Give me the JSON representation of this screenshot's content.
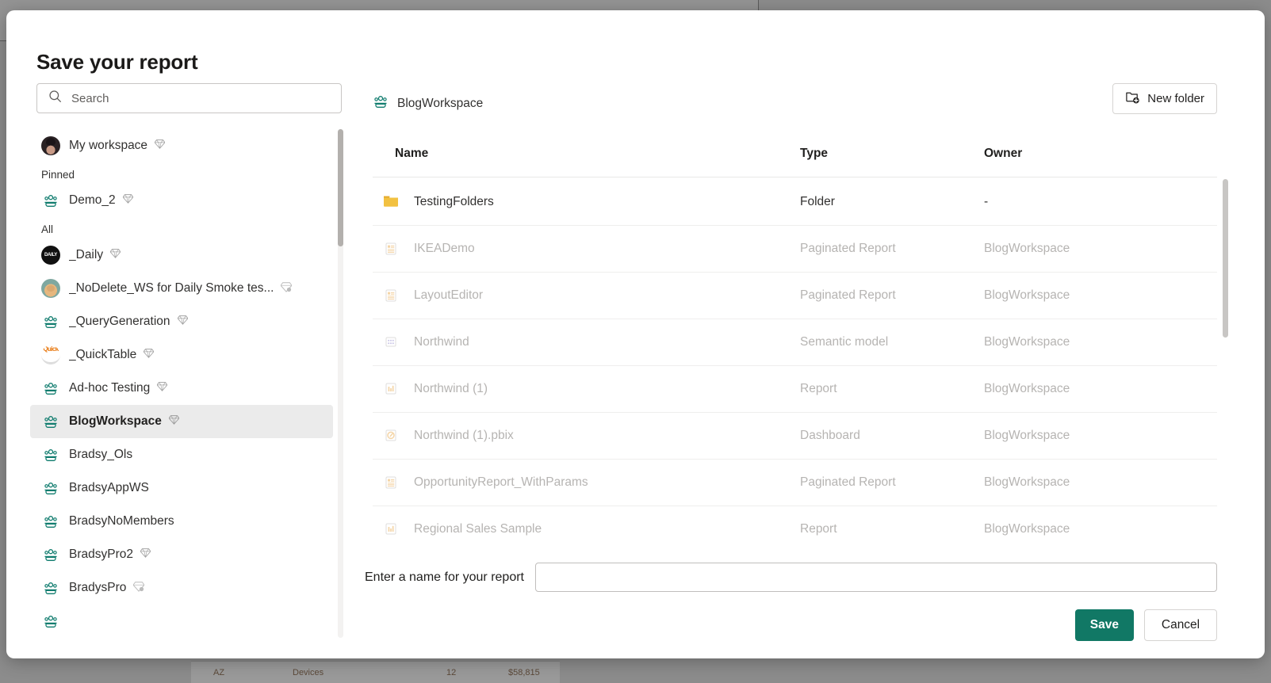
{
  "background": {
    "row": {
      "state": "AZ",
      "category": "Devices",
      "count": "12",
      "amount": "$58,815"
    }
  },
  "dialog": {
    "title": "Save your report",
    "search": {
      "placeholder": "Search",
      "value": "",
      "icon": "search-icon"
    },
    "sidebar": {
      "top_item": {
        "label": "My workspace",
        "icon": "avatar-person",
        "badge": "diamond-icon"
      },
      "sections": [
        {
          "title": "Pinned",
          "items": [
            {
              "label": "Demo_2",
              "icon": "workspace-icon",
              "badge": "diamond-icon",
              "selected": false
            }
          ]
        },
        {
          "title": "All",
          "items": [
            {
              "label": "_Daily",
              "icon": "avatar-dark",
              "avatar_text": "DAILY",
              "badge": "diamond-icon",
              "selected": false
            },
            {
              "label": "_NoDelete_WS for Daily Smoke tes...",
              "icon": "avatar-dog",
              "badge": "diamond-shared-icon",
              "selected": false
            },
            {
              "label": "_QueryGeneration",
              "icon": "workspace-icon",
              "badge": "diamond-icon",
              "selected": false
            },
            {
              "label": "_QuickTable",
              "icon": "avatar-quick",
              "avatar_text": "Quick",
              "badge": "diamond-icon",
              "selected": false
            },
            {
              "label": "Ad-hoc Testing",
              "icon": "workspace-icon",
              "badge": "diamond-icon",
              "selected": false
            },
            {
              "label": "BlogWorkspace",
              "icon": "workspace-icon",
              "badge": "diamond-icon",
              "selected": true
            },
            {
              "label": "Bradsy_Ols",
              "icon": "workspace-icon",
              "badge": "",
              "selected": false
            },
            {
              "label": "BradsyAppWS",
              "icon": "workspace-icon",
              "badge": "",
              "selected": false
            },
            {
              "label": "BradsyNoMembers",
              "icon": "workspace-icon",
              "badge": "",
              "selected": false
            },
            {
              "label": "BradsyPro2",
              "icon": "workspace-icon",
              "badge": "diamond-icon",
              "selected": false
            },
            {
              "label": "BradysPro",
              "icon": "workspace-icon",
              "badge": "diamond-shared-icon",
              "selected": false
            }
          ]
        }
      ]
    },
    "content": {
      "breadcrumb": {
        "label": "BlogWorkspace",
        "icon": "workspace-icon"
      },
      "new_folder_button": {
        "label": "New folder",
        "icon": "new-folder-icon"
      },
      "columns": {
        "name": "Name",
        "type": "Type",
        "owner": "Owner"
      },
      "rows": [
        {
          "name": "TestingFolders",
          "type": "Folder",
          "owner": "-",
          "icon": "folder-icon",
          "enabled": true
        },
        {
          "name": "IKEADemo",
          "type": "Paginated Report",
          "owner": "BlogWorkspace",
          "icon": "paginated-report-icon",
          "enabled": false
        },
        {
          "name": "LayoutEditor",
          "type": "Paginated Report",
          "owner": "BlogWorkspace",
          "icon": "paginated-report-icon",
          "enabled": false
        },
        {
          "name": "Northwind",
          "type": "Semantic model",
          "owner": "BlogWorkspace",
          "icon": "semantic-model-icon",
          "enabled": false
        },
        {
          "name": "Northwind (1)",
          "type": "Report",
          "owner": "BlogWorkspace",
          "icon": "report-icon",
          "enabled": false
        },
        {
          "name": "Northwind (1).pbix",
          "type": "Dashboard",
          "owner": "BlogWorkspace",
          "icon": "dashboard-icon",
          "enabled": false
        },
        {
          "name": "OpportunityReport_WithParams",
          "type": "Paginated Report",
          "owner": "BlogWorkspace",
          "icon": "paginated-report-icon",
          "enabled": false
        },
        {
          "name": "Regional Sales Sample",
          "type": "Report",
          "owner": "BlogWorkspace",
          "icon": "report-icon",
          "enabled": false
        }
      ]
    },
    "footer": {
      "name_label": "Enter a name for your report",
      "name_value": "",
      "name_placeholder": "",
      "save_label": "Save",
      "cancel_label": "Cancel"
    },
    "colors": {
      "accent": "#117865",
      "workspace_icon": "#107c6e",
      "folder": "#f2c141",
      "selected_row_bg": "#ebebeb"
    }
  }
}
